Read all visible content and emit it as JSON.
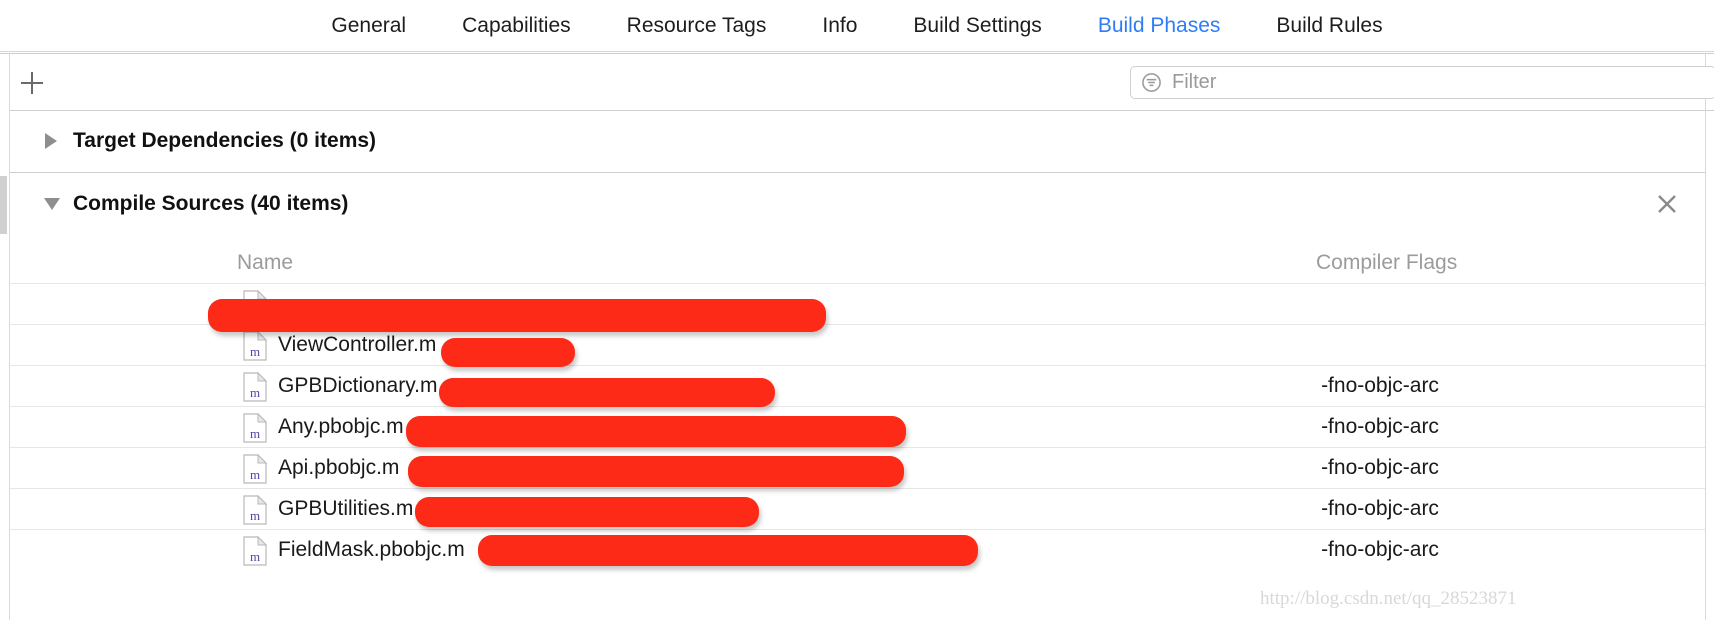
{
  "tabs": [
    {
      "label": "General",
      "active": false
    },
    {
      "label": "Capabilities",
      "active": false
    },
    {
      "label": "Resource Tags",
      "active": false
    },
    {
      "label": "Info",
      "active": false
    },
    {
      "label": "Build Settings",
      "active": false
    },
    {
      "label": "Build Phases",
      "active": true
    },
    {
      "label": "Build Rules",
      "active": false
    }
  ],
  "toolbar": {
    "add_button": "+",
    "add_icon": "plus-icon",
    "filter": {
      "icon": "filter-icon",
      "placeholder": "Filter",
      "value": ""
    }
  },
  "sections": [
    {
      "title": "Target Dependencies (0 items)",
      "expanded": false,
      "disclosure_icon": "triangle-right-icon"
    },
    {
      "title": "Compile Sources (40 items)",
      "expanded": true,
      "disclosure_icon": "triangle-down-icon",
      "close_icon": "close-icon"
    }
  ],
  "table": {
    "columns": [
      "Name",
      "Compiler Flags"
    ],
    "rows": [
      {
        "name": "",
        "icon": "objc-m-file-icon",
        "flags": "",
        "redacted_name": true
      },
      {
        "name": "ViewController.m",
        "icon": "objc-m-file-icon",
        "flags": ""
      },
      {
        "name": "GPBDictionary.m",
        "icon": "objc-m-file-icon",
        "flags": "-fno-objc-arc"
      },
      {
        "name": "Any.pbobjc.m",
        "icon": "objc-m-file-icon",
        "flags": "-fno-objc-arc"
      },
      {
        "name": "Api.pbobjc.m",
        "icon": "objc-m-file-icon",
        "flags": "-fno-objc-arc"
      },
      {
        "name": "GPBUtilities.m",
        "icon": "objc-m-file-icon",
        "flags": "-fno-objc-arc"
      },
      {
        "name": "FieldMask.pbobjc.m",
        "icon": "objc-m-file-icon",
        "flags": "-fno-objc-arc"
      }
    ]
  },
  "watermark": "http://blog.csdn.net/qq_28523871",
  "colors": {
    "accent": "#2e7df6",
    "redaction": "#FC2A16",
    "header_text": "#9b9b9b",
    "body_text": "#1a1a1a"
  }
}
